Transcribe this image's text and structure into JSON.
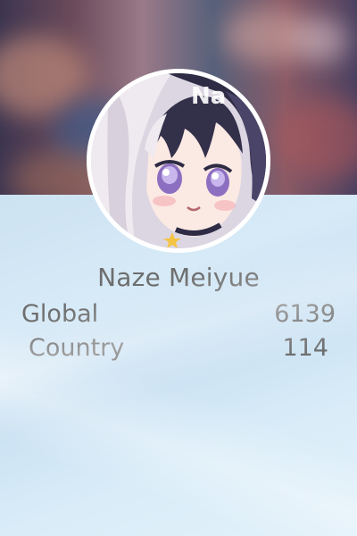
{
  "profile": {
    "username": "Naze Meiyue",
    "avatar_icon": "anime-girl-avatar",
    "avatar_overlay_text": "Na"
  },
  "ranks": {
    "global_label": "Global",
    "global_value": "6139",
    "country_label": "Country",
    "country_value": "114"
  },
  "colors": {
    "text": "#6e6e6e",
    "avatar_border": "#ffffff",
    "background": "#cfe4f3"
  }
}
